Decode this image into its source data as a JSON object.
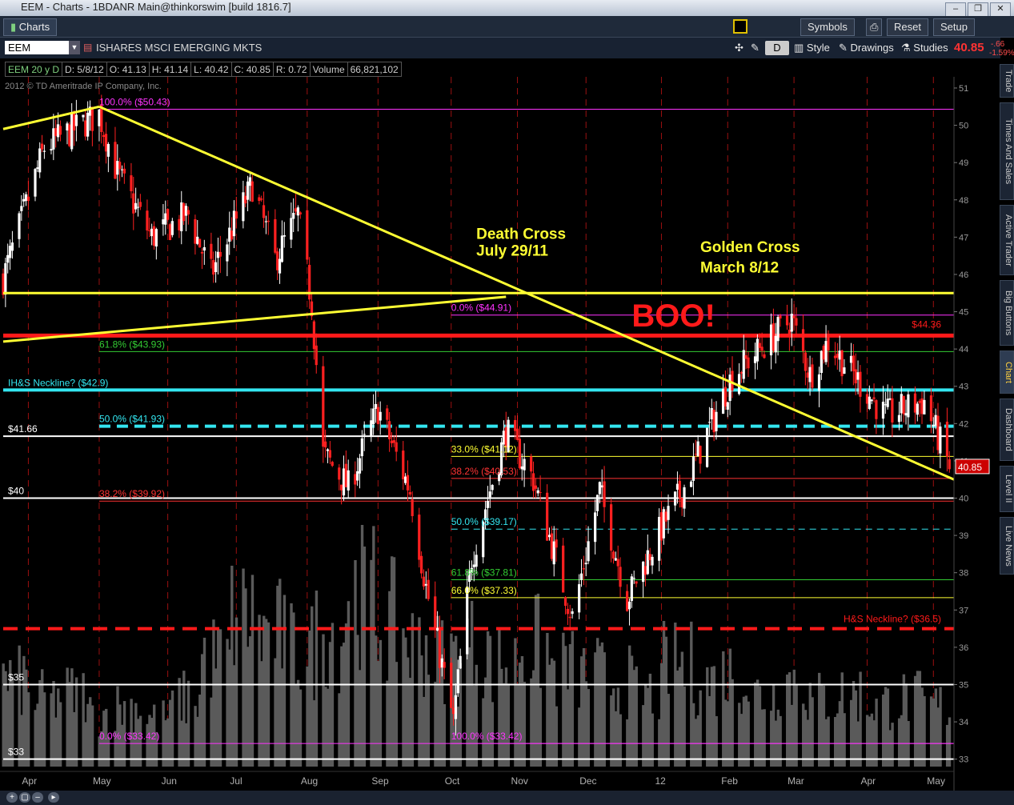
{
  "window": {
    "title": "EEM - Charts - 1BDANR Main@thinkorswim [build 1816.7]",
    "buttons": [
      "–",
      "❐",
      "✕"
    ]
  },
  "toolbar": {
    "charts_tab": "Charts",
    "symbols": "Symbols",
    "reset": "Reset",
    "setup": "Setup"
  },
  "symbol_bar": {
    "symbol": "EEM",
    "name": "ISHARES MSCI EMERGING MKTS",
    "aggregation": "D",
    "style": "Style",
    "drawings": "Drawings",
    "studies": "Studies",
    "last_price": "40.85",
    "change_abs": "-.66",
    "change_pct": "-1.59%"
  },
  "info_bar": [
    "EEM 20 y D",
    "D: 5/8/12",
    "O: 41.13",
    "H: 41.14",
    "L: 40.42",
    "C: 40.85",
    "R: 0.72",
    "Volume",
    "66,821,102"
  ],
  "copyright": "2012 © TD Ameritrade IP Company, Inc.",
  "side_tabs": [
    "Trade",
    "Times And Sales",
    "Active Trader",
    "Big Buttons",
    "Chart",
    "Dashboard",
    "Level II",
    "Live News"
  ],
  "colors": {
    "up": "#ffffff",
    "down": "#ff2020",
    "volume": "#5a5a5a",
    "trend": "#ffff33",
    "neckline": "#33e6f0",
    "resistance": "#ff1a1a",
    "background": "#000000",
    "price_box": "#cc0000"
  },
  "chart_data": {
    "type": "candlestick",
    "title": "ISHARES MSCI EMERGING MKTS",
    "ylim": [
      32.8,
      51.3
    ],
    "x_tick_labels": [
      {
        "label": "Apr",
        "x": "2011-04-01"
      },
      {
        "label": "May",
        "x": "2011-05-02"
      },
      {
        "label": "Jun",
        "x": "2011-06-01"
      },
      {
        "label": "Jul",
        "x": "2011-07-01"
      },
      {
        "label": "Aug",
        "x": "2011-08-01"
      },
      {
        "label": "Sep",
        "x": "2011-09-01"
      },
      {
        "label": "Oct",
        "x": "2011-10-03"
      },
      {
        "label": "Nov",
        "x": "2011-11-01"
      },
      {
        "label": "Dec",
        "x": "2011-12-01"
      },
      {
        "label": "12",
        "x": "2012-01-03"
      },
      {
        "label": "Feb",
        "x": "2012-02-01"
      },
      {
        "label": "Mar",
        "x": "2012-03-01"
      },
      {
        "label": "Apr",
        "x": "2012-04-02"
      },
      {
        "label": "May",
        "x": "2012-05-01"
      }
    ],
    "y_ticks": [
      33,
      34,
      35,
      36,
      37,
      38,
      39,
      40,
      41,
      42,
      43,
      44,
      45,
      46,
      47,
      48,
      49,
      50,
      51
    ],
    "price_path": [
      {
        "date": "2011-03-21",
        "price": 45.9
      },
      {
        "date": "2011-04-08",
        "price": 49.4
      },
      {
        "date": "2011-04-21",
        "price": 49.9
      },
      {
        "date": "2011-05-02",
        "price": 50.3
      },
      {
        "date": "2011-05-10",
        "price": 48.7
      },
      {
        "date": "2011-05-25",
        "price": 47.0
      },
      {
        "date": "2011-06-10",
        "price": 47.6
      },
      {
        "date": "2011-06-20",
        "price": 46.0
      },
      {
        "date": "2011-07-08",
        "price": 48.4
      },
      {
        "date": "2011-07-18",
        "price": 46.4
      },
      {
        "date": "2011-07-28",
        "price": 47.6
      },
      {
        "date": "2011-08-03",
        "price": 45.2
      },
      {
        "date": "2011-08-08",
        "price": 41.2
      },
      {
        "date": "2011-08-19",
        "price": 40.3
      },
      {
        "date": "2011-09-01",
        "price": 42.4
      },
      {
        "date": "2011-09-15",
        "price": 40.2
      },
      {
        "date": "2011-09-22",
        "price": 37.6
      },
      {
        "date": "2011-10-04",
        "price": 34.0
      },
      {
        "date": "2011-10-12",
        "price": 38.4
      },
      {
        "date": "2011-10-27",
        "price": 41.8
      },
      {
        "date": "2011-11-08",
        "price": 40.5
      },
      {
        "date": "2011-11-25",
        "price": 36.8
      },
      {
        "date": "2011-12-07",
        "price": 40.2
      },
      {
        "date": "2011-12-19",
        "price": 37.3
      },
      {
        "date": "2012-01-03",
        "price": 39.2
      },
      {
        "date": "2012-01-13",
        "price": 40.3
      },
      {
        "date": "2012-02-03",
        "price": 43.3
      },
      {
        "date": "2012-02-29",
        "price": 44.8
      },
      {
        "date": "2012-03-08",
        "price": 43.3
      },
      {
        "date": "2012-03-16",
        "price": 44.2
      },
      {
        "date": "2012-04-10",
        "price": 42.2
      },
      {
        "date": "2012-04-27",
        "price": 42.6
      },
      {
        "date": "2012-05-08",
        "price": 40.85
      }
    ],
    "volume_level": [
      0.35,
      0.28,
      0.3,
      0.22,
      0.25,
      0.2,
      0.28,
      0.45,
      0.62,
      0.55,
      0.48,
      0.55,
      0.72,
      0.6,
      0.5,
      0.45,
      0.5,
      0.42,
      0.5,
      0.4,
      0.38,
      0.35,
      0.3,
      0.42,
      0.35,
      0.38,
      0.3,
      0.36,
      0.28,
      0.3,
      0.26,
      0.28,
      0.25
    ],
    "horizontal_lines": [
      {
        "price": 41.66,
        "label": "$41.66",
        "color": "#ffffff"
      },
      {
        "price": 40.0,
        "label": "$40",
        "color": "#ffffff"
      },
      {
        "price": 35.0,
        "label": "$35",
        "color": "#ffffff"
      },
      {
        "price": 33.0,
        "label": "$33",
        "color": "#ffffff"
      },
      {
        "price": 42.9,
        "label": "IH&S Neckline? ($42.9)",
        "color": "#33e6f0"
      },
      {
        "price": 44.36,
        "label": "$44.36",
        "color": "#ff1a1a"
      },
      {
        "price": 36.5,
        "label": "H&S Neckline? ($36.5)",
        "color": "#ff1a1a"
      }
    ],
    "fib_levels_1": [
      {
        "label": "100.0%  ($50.43)",
        "price": 50.43,
        "color": "#ff33ff"
      },
      {
        "label": "61.8%  ($43.93)",
        "price": 43.93,
        "color": "#33cc33"
      },
      {
        "label": "50.0%  ($41.93)",
        "price": 41.93,
        "color": "#33e6f0"
      },
      {
        "label": "38.2%  ($39.92)",
        "price": 39.92,
        "color": "#ff3333"
      },
      {
        "label": "0.0%  ($33.42)",
        "price": 33.42,
        "color": "#ff33ff"
      }
    ],
    "fib_levels_2": [
      {
        "label": "0.0%  ($44.91)",
        "price": 44.91,
        "color": "#ff33ff"
      },
      {
        "label": "33.0%  ($41.12)",
        "price": 41.12,
        "color": "#ffff33"
      },
      {
        "label": "38.2%  ($40.53)",
        "price": 40.53,
        "color": "#ff3333"
      },
      {
        "label": "50.0%  ($39.17)",
        "price": 39.17,
        "color": "#33e6f0"
      },
      {
        "label": "61.8%  ($37.81)",
        "price": 37.81,
        "color": "#33cc33"
      },
      {
        "label": "66.0%  ($37.33)",
        "price": 37.33,
        "color": "#ffff33"
      },
      {
        "label": "100.0%  ($33.42)",
        "price": 33.42,
        "color": "#ff33ff"
      }
    ],
    "trendlines": [
      {
        "from": {
          "date": "2011-03-21",
          "price": 49.9
        },
        "to": {
          "date": "2011-05-02",
          "price": 50.5
        }
      },
      {
        "from": {
          "date": "2011-05-02",
          "price": 50.5
        },
        "to": {
          "date": "2012-05-10",
          "price": 40.5
        }
      },
      {
        "from": {
          "date": "2011-03-21",
          "price": 45.5
        },
        "to": {
          "date": "2012-05-10",
          "price": 45.5
        }
      },
      {
        "from": {
          "date": "2011-03-21",
          "price": 44.2
        },
        "to": {
          "date": "2011-10-27",
          "price": 45.4
        }
      }
    ],
    "annotations": [
      {
        "text": "Death Cross",
        "date": "2011-10-14",
        "price": 46.95,
        "color": "#ffff33"
      },
      {
        "text": "July 29/11",
        "date": "2011-10-14",
        "price": 46.5,
        "color": "#ffff33"
      },
      {
        "text": "Golden Cross",
        "date": "2012-01-20",
        "price": 46.6,
        "color": "#ffff33"
      },
      {
        "text": "March 8/12",
        "date": "2012-01-20",
        "price": 46.05,
        "color": "#ffff33"
      },
      {
        "text": "BOO!",
        "date": "2011-12-21",
        "price": 44.6,
        "color": "#ff1a1a"
      }
    ],
    "current_price_box": {
      "text": "40.85",
      "price": 40.85
    }
  }
}
